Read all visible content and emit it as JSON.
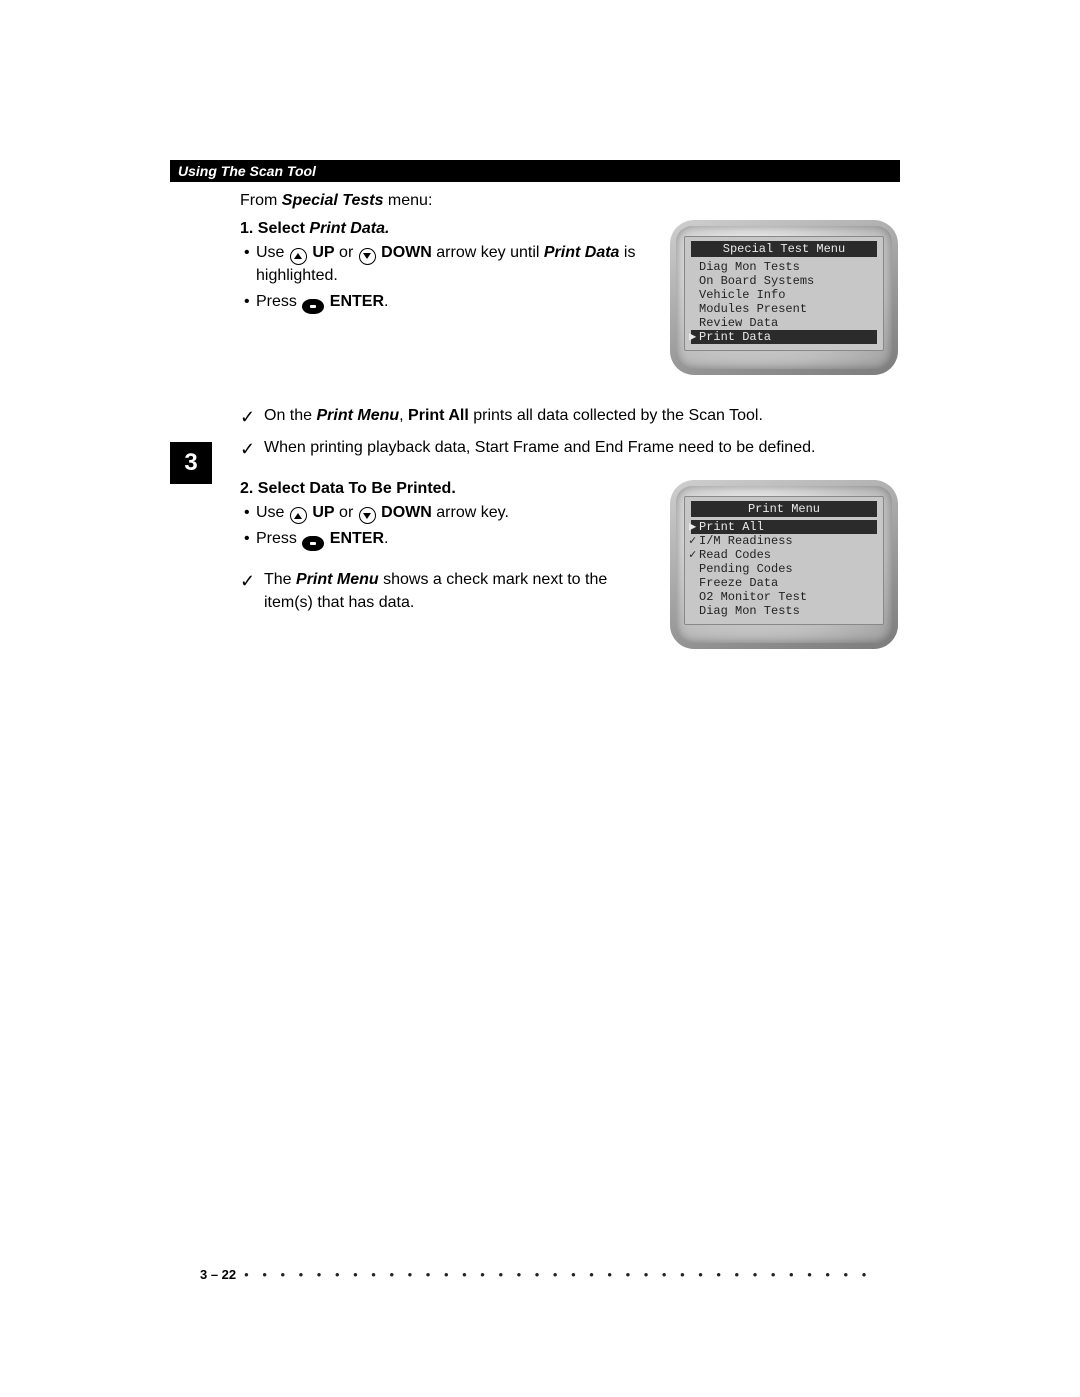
{
  "header": "Using The Scan Tool",
  "chapterTab": "3",
  "intro": {
    "pre": "From ",
    "boldItalic": "Special Tests",
    "post": " menu:"
  },
  "step1": {
    "number": "1.",
    "labelPlain": "Select ",
    "labelItalic": "Print Data.",
    "sub1": {
      "p1": "Use ",
      "up": "UP",
      "mid": " or ",
      "down": "DOWN",
      "p2": " arrow key until ",
      "target": "Print Data",
      "p3": " is highlighted."
    },
    "sub2": {
      "p1": "Press ",
      "enter": "ENTER",
      "p2": "."
    }
  },
  "notes1": [
    {
      "p1": "On the ",
      "b1": "Print Menu",
      "p2": ", ",
      "b2": "Print All",
      "p3": " prints all data collected by the Scan Tool."
    },
    {
      "p": "When printing playback data, Start Frame and End Frame need to be defined."
    }
  ],
  "step2": {
    "number": "2.",
    "label": "Select Data To Be Printed.",
    "sub1": {
      "p1": "Use ",
      "up": "UP",
      "mid": " or ",
      "down": "DOWN",
      "p2": " arrow key."
    },
    "sub2": {
      "p1": "Press ",
      "enter": "ENTER",
      "p2": "."
    }
  },
  "notes2": [
    {
      "p1": "The ",
      "b1": "Print Menu",
      "p2": " shows a check mark next to the item(s) that has data."
    }
  ],
  "screen1": {
    "title": "Special Test Menu",
    "lines": [
      {
        "text": "Diag Mon Tests"
      },
      {
        "text": "On Board Systems"
      },
      {
        "text": "Vehicle Info"
      },
      {
        "text": "Modules Present"
      },
      {
        "text": "Review Data"
      },
      {
        "text": "Print Data",
        "selected": true,
        "cursor": true
      }
    ]
  },
  "screen2": {
    "title": "Print Menu",
    "lines": [
      {
        "text": "Print All",
        "selected": true,
        "cursor": true
      },
      {
        "text": "I/M Readiness",
        "check": true
      },
      {
        "text": "Read Codes",
        "check": true
      },
      {
        "text": "Pending Codes"
      },
      {
        "text": "Freeze Data"
      },
      {
        "text": "O2 Monitor Test"
      },
      {
        "text": "Diag Mon Tests"
      }
    ]
  },
  "pageNumber": "3 – 22",
  "dots": "• • • • • • • • • • • • • • • • • • • • • • • • • • • • • • • • • • • • • • • • • • • • • • • • • • • • • •"
}
